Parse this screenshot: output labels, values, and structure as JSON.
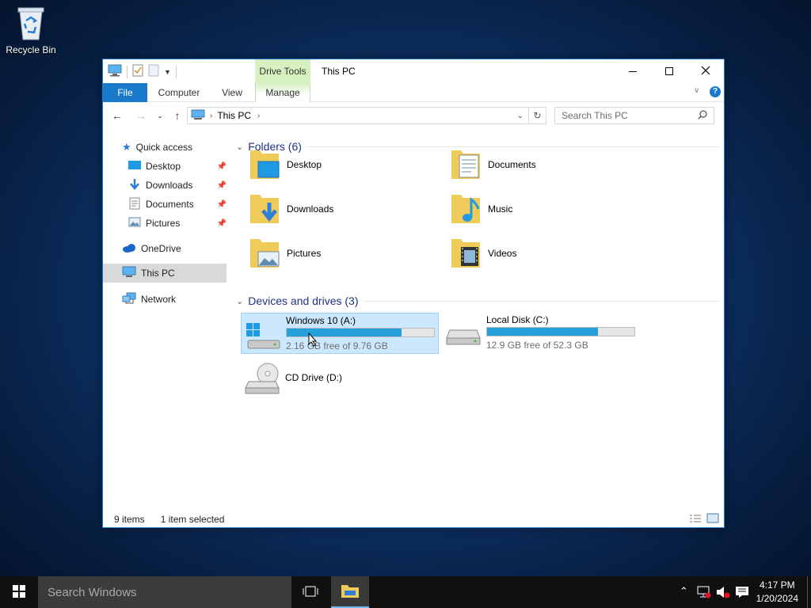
{
  "desktop": {
    "recycle_bin_label": "Recycle Bin"
  },
  "window": {
    "title": "This PC",
    "context_tab_group": "Drive Tools",
    "ribbon_tabs": {
      "file": "File",
      "computer": "Computer",
      "view": "View",
      "manage": "Manage"
    },
    "address": {
      "crumb": "This PC"
    },
    "search_placeholder": "Search This PC"
  },
  "nav": {
    "quick_access": "Quick access",
    "desktop": "Desktop",
    "downloads": "Downloads",
    "documents": "Documents",
    "pictures": "Pictures",
    "onedrive": "OneDrive",
    "this_pc": "This PC",
    "network": "Network"
  },
  "content": {
    "folders_header": "Folders (6)",
    "folders": [
      "Desktop",
      "Documents",
      "Downloads",
      "Music",
      "Pictures",
      "Videos"
    ],
    "drives_header": "Devices and drives (3)",
    "drives": [
      {
        "name": "Windows 10 (A:)",
        "free": "2.16 GB free of 9.76 GB",
        "used_pct": 78,
        "selected": true
      },
      {
        "name": "Local Disk (C:)",
        "free": "12.9 GB free of 52.3 GB",
        "used_pct": 75,
        "selected": false
      },
      {
        "name": "CD Drive (D:)"
      }
    ]
  },
  "status": {
    "items": "9 items",
    "selection": "1 item selected"
  },
  "taskbar": {
    "search_placeholder": "Search Windows",
    "time": "4:17 PM",
    "date": "1/20/2024"
  },
  "colors": {
    "accent": "#1979ca",
    "drive_bar": "#26a0da",
    "folder_yellow": "#f0cb5a"
  }
}
